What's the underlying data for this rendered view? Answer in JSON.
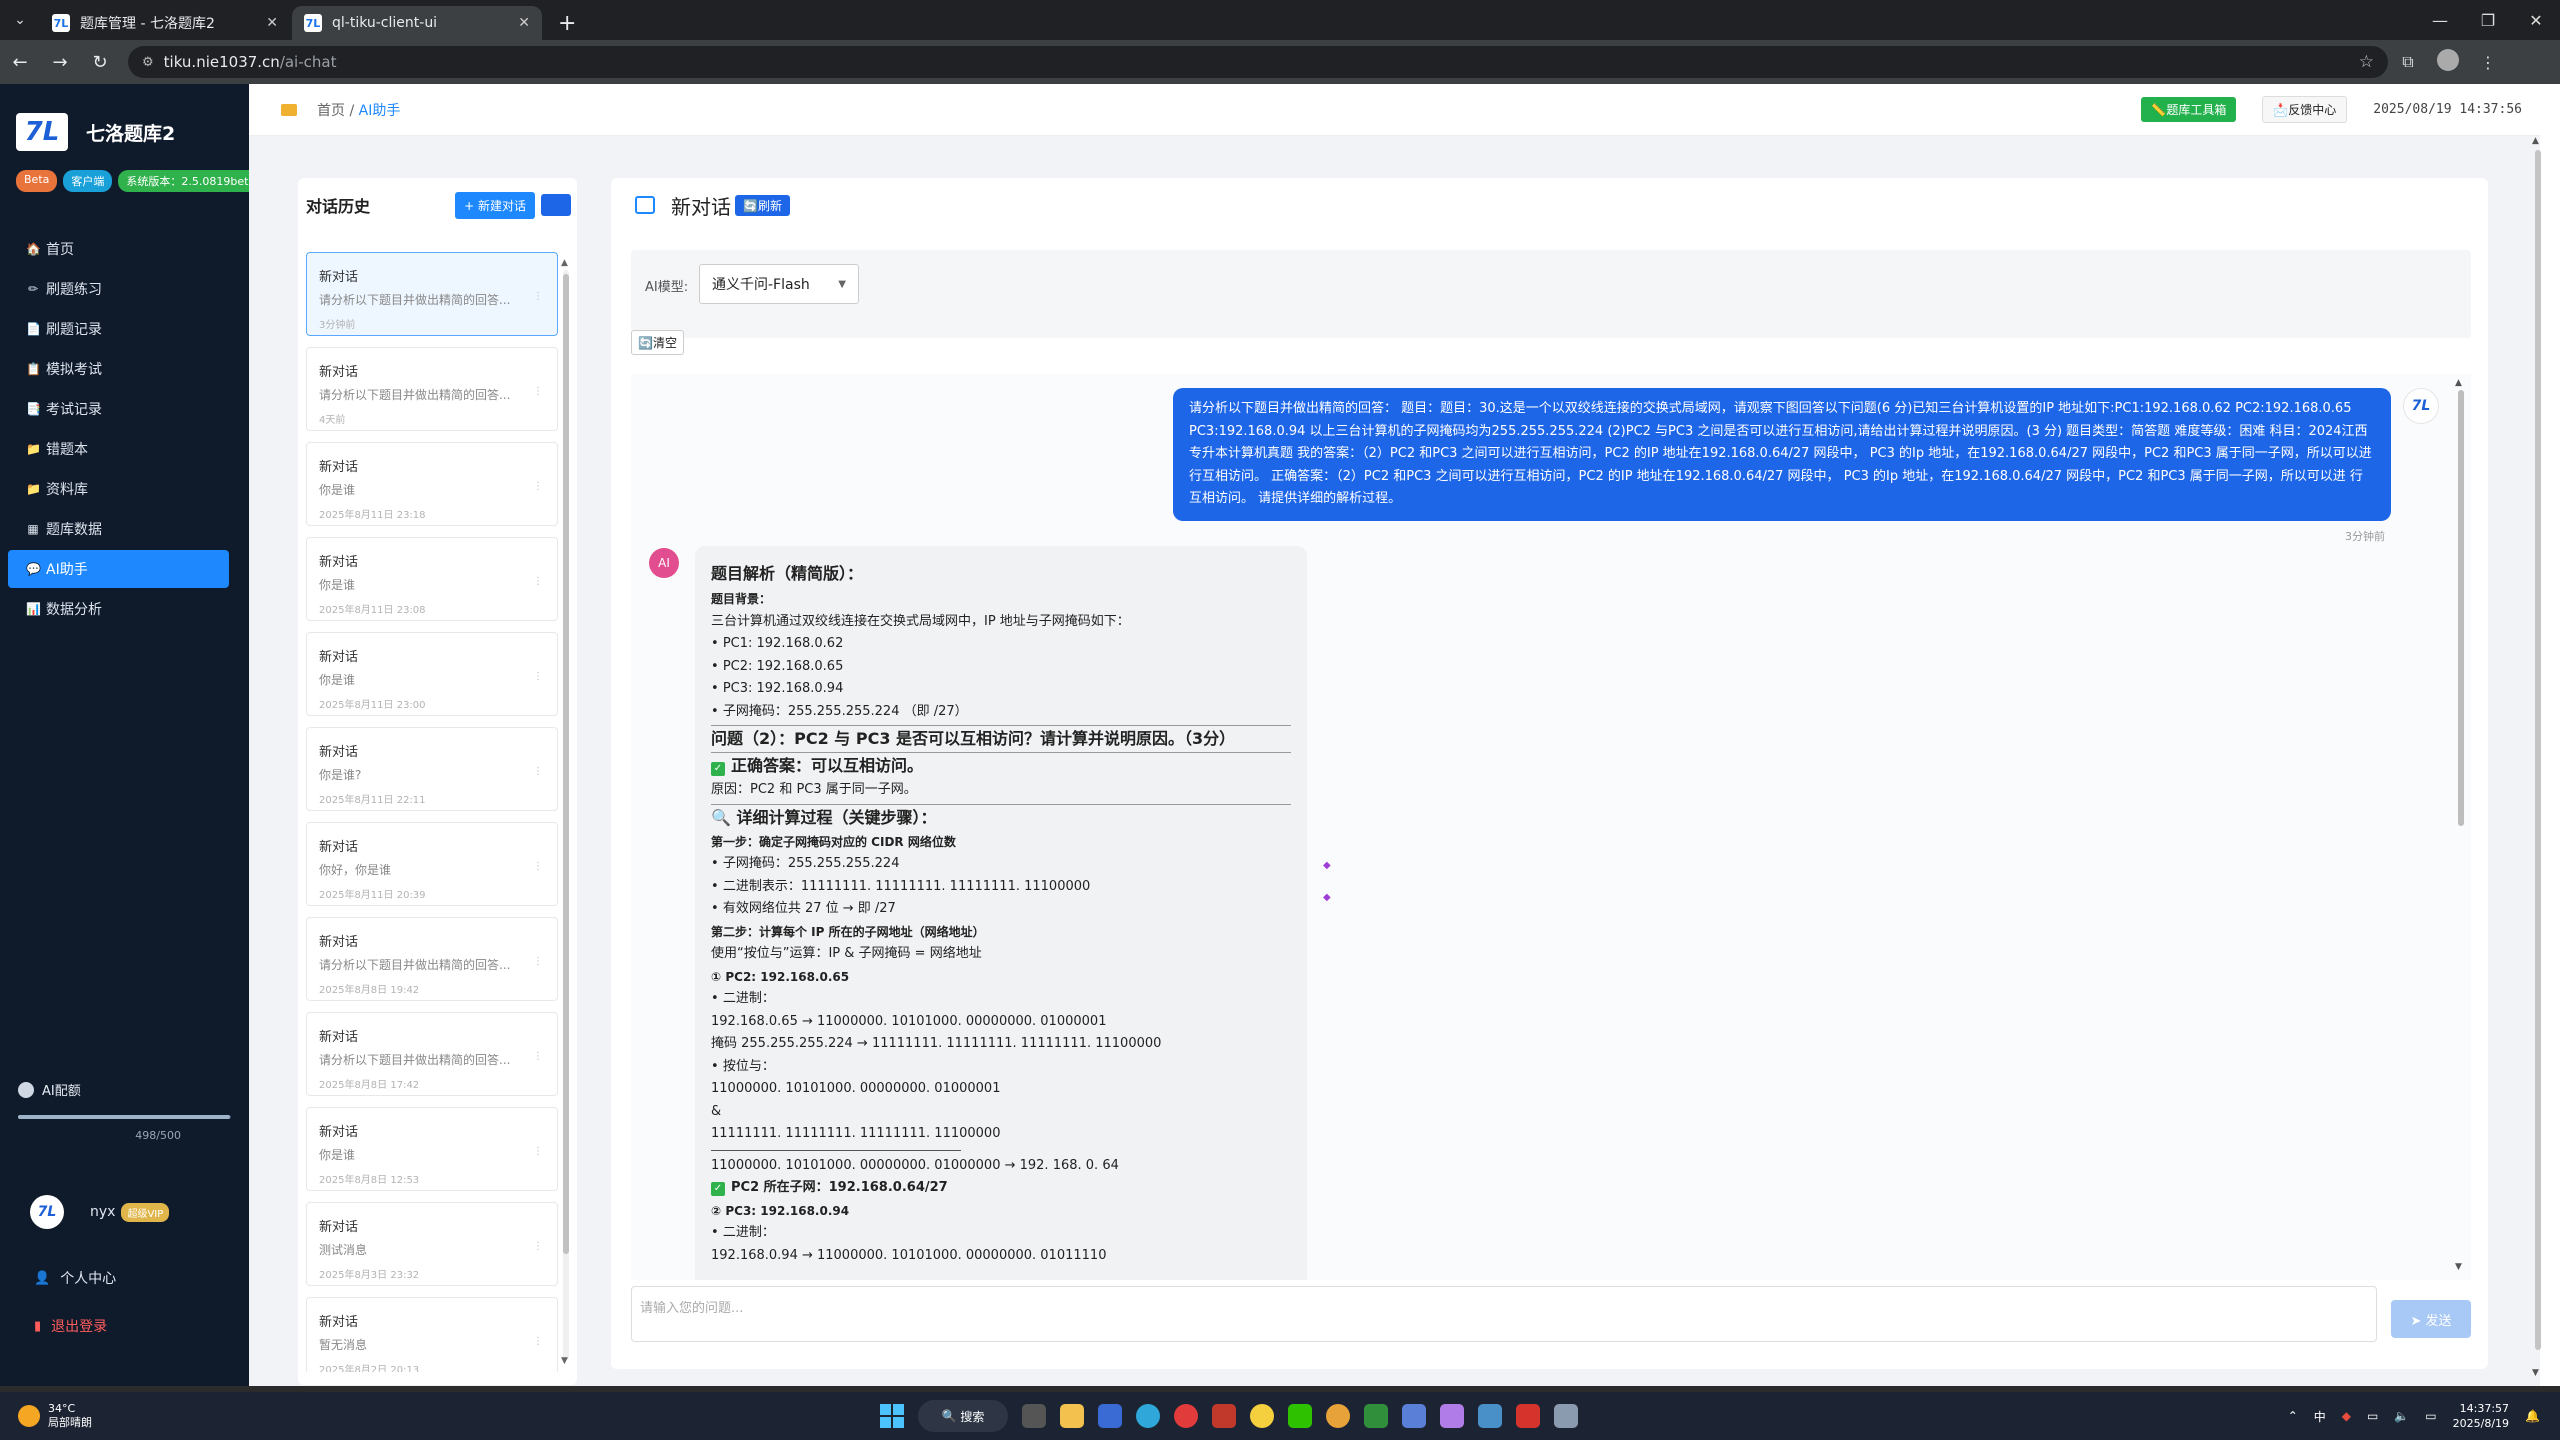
{
  "browser": {
    "tabs": [
      {
        "title": "题库管理 - 七洛题库2",
        "active": false
      },
      {
        "title": "ql-tiku-client-ui",
        "active": true
      }
    ],
    "url_host": "tiku.nie1037.cn",
    "url_path": "/ai-chat"
  },
  "sidebar": {
    "brand": "七洛题库2",
    "logo_text": "7L",
    "badges": [
      {
        "label": "Beta",
        "color": "#e8743b"
      },
      {
        "label": "客户端",
        "color": "#1aa0d8"
      },
      {
        "label": "系统版本：2.5.0819beta",
        "color": "#2fb14c"
      }
    ],
    "menu": [
      {
        "label": "首页",
        "icon": "home-icon",
        "glyph": "🏠",
        "active": false
      },
      {
        "label": "刷题练习",
        "icon": "pencil-icon",
        "glyph": "✏",
        "active": false
      },
      {
        "label": "刷题记录",
        "icon": "record-icon",
        "glyph": "📄",
        "active": false
      },
      {
        "label": "模拟考试",
        "icon": "exam-icon",
        "glyph": "📋",
        "active": false
      },
      {
        "label": "考试记录",
        "icon": "exam-record-icon",
        "glyph": "📑",
        "active": false
      },
      {
        "label": "错题本",
        "icon": "folder-icon",
        "glyph": "📁",
        "active": false
      },
      {
        "label": "资料库",
        "icon": "library-icon",
        "glyph": "📁",
        "active": false
      },
      {
        "label": "题库数据",
        "icon": "data-icon",
        "glyph": "▦",
        "active": false
      },
      {
        "label": "AI助手",
        "icon": "ai-chat-icon",
        "glyph": "💬",
        "active": true
      },
      {
        "label": "数据分析",
        "icon": "chart-icon",
        "glyph": "📊",
        "active": false
      }
    ],
    "quota_title": "AI配额",
    "quota_text": "498/500",
    "quota_fraction": 0.996,
    "user_name": "nyx",
    "vip_label": "超级VIP",
    "profile_link": "个人中心",
    "logout_link": "退出登录"
  },
  "header": {
    "breadcrumb_home": "首页",
    "breadcrumb_sep": "/",
    "breadcrumb_current": "AI助手",
    "tool_button": "📏题库工具箱",
    "feedback_button": "📩反馈中心",
    "clock": "2025/08/19 14:37:56"
  },
  "history": {
    "title": "对话历史",
    "new_button": "+ 新建对话",
    "items": [
      {
        "title": "新对话",
        "preview": "请分析以下题目并做出精简的回答...",
        "time": "3分钟前",
        "active": true
      },
      {
        "title": "新对话",
        "preview": "请分析以下题目并做出精简的回答...",
        "time": "4天前",
        "active": false
      },
      {
        "title": "新对话",
        "preview": "你是谁",
        "time": "2025年8月11日 23:18",
        "active": false
      },
      {
        "title": "新对话",
        "preview": "你是谁",
        "time": "2025年8月11日 23:08",
        "active": false
      },
      {
        "title": "新对话",
        "preview": "你是谁",
        "time": "2025年8月11日 23:00",
        "active": false
      },
      {
        "title": "新对话",
        "preview": "你是谁?",
        "time": "2025年8月11日 22:11",
        "active": false
      },
      {
        "title": "新对话",
        "preview": "你好，你是谁",
        "time": "2025年8月11日 20:39",
        "active": false
      },
      {
        "title": "新对话",
        "preview": "请分析以下题目并做出精简的回答...",
        "time": "2025年8月8日 19:42",
        "active": false
      },
      {
        "title": "新对话",
        "preview": "请分析以下题目并做出精简的回答...",
        "time": "2025年8月8日 17:42",
        "active": false
      },
      {
        "title": "新对话",
        "preview": "你是谁",
        "time": "2025年8月8日 12:53",
        "active": false
      },
      {
        "title": "新对话",
        "preview": "测试消息",
        "time": "2025年8月3日 23:32",
        "active": false
      },
      {
        "title": "新对话",
        "preview": "暂无消息",
        "time": "2025年8月2日 20:13",
        "active": false
      }
    ]
  },
  "chat": {
    "title": "新对话",
    "refresh_button": "🔄刷新",
    "model_label": "AI模型:",
    "model_value": "通义千问-Flash",
    "clear_button": "🔄清空",
    "user_message": "请分析以下题目并做出精简的回答： 题目：题目：30.这是一个以双绞线连接的交换式局域网，请观察下图回答以下问题(6 分)已知三台计算机设置的IP 地址如下:PC1:192.168.0.62 PC2:192.168.0.65 PC3:192.168.0.94 以上三台计算机的子网掩码均为255.255.255.224 (2)PC2 与PC3 之间是否可以进行互相访问,请给出计算过程并说明原因。(3 分) 题目类型：简答题 难度等级：困难 科目：2024江西专升本计算机真题 我的答案：（2）PC2 和PC3 之间可以进行互相访问，PC2 的IP 地址在192.168.0.64/27 网段中， PC3 的Ip 地址，在192.168.0.64/27 网段中，PC2 和PC3 属于同一子网，所以可以进 行互相访问。 正确答案：（2）PC2 和PC3 之间可以进行互相访问，PC2 的IP 地址在192.168.0.64/27 网段中， PC3 的Ip 地址，在192.168.0.64/27 网段中，PC2 和PC3 属于同一子网，所以可以进 行互相访问。 请提供详细的解析过程。",
    "user_time": "3分钟前",
    "ai_avatar": "AI",
    "ai": {
      "title": "题目解析（精简版）：",
      "bg_label": "题目背景：",
      "bg_text": "三台计算机通过双绞线连接在交换式局域网中，IP 地址与子网掩码如下：",
      "bg_items": [
        "PC1: 192.168.0.62",
        "PC2: 192.168.0.65",
        "PC3: 192.168.0.94",
        "子网掩码：255.255.255.224 （即 /27）"
      ],
      "q_title": "问题（2）：PC2 与 PC3 是否可以互相访问？请计算并说明原因。（3分）",
      "ans_title": "正确答案：可以互相访问。",
      "reason": "原因：PC2 和 PC3 属于同一子网。",
      "detail_title": "🔍 详细计算过程（关键步骤）：",
      "step1": "第一步：确定子网掩码对应的 CIDR 网络位数",
      "step1_items": [
        "子网掩码：255.255.255.224",
        "二进制表示：11111111. 11111111. 11111111. 11100000",
        "有效网络位共 27 位 → 即 /27"
      ],
      "step2": "第二步：计算每个 IP 所在的子网地址（网络地址）",
      "step2_text": "使用“按位与”运算：IP & 子网掩码 = 网络地址",
      "pc2_label": "① PC2: 192.168.0.65",
      "bin_label": "二进制：",
      "pc2_bin": "192.168.0.65 → 11000000. 10101000. 00000000. 01000001",
      "mask_bin": "掩码 255.255.255.224 → 11111111. 11111111. 11111111. 11100000",
      "and_label": "按位与：",
      "and_l1": "11000000. 10101000. 00000000. 01000001",
      "and_op": "&",
      "and_l2": "11111111. 11111111. 11111111. 11100000",
      "and_res": "11000000. 10101000. 00000000. 01000000  → 192. 168. 0. 64",
      "pc2_subnet": "PC2 所在子网：192.168.0.64/27",
      "pc3_label": "② PC3: 192.168.0.94",
      "bin_label2": "二进制：",
      "pc3_bin": "192.168.0.94 → 11000000. 10101000. 00000000. 01011110"
    },
    "input_placeholder": "请输入您的问题...",
    "send_button": "➤ 发送"
  },
  "taskbar": {
    "temp": "34°C",
    "weather": "局部晴朗",
    "search": "搜索",
    "ime": "中",
    "time": "14:37:57",
    "date": "2025/8/19"
  }
}
